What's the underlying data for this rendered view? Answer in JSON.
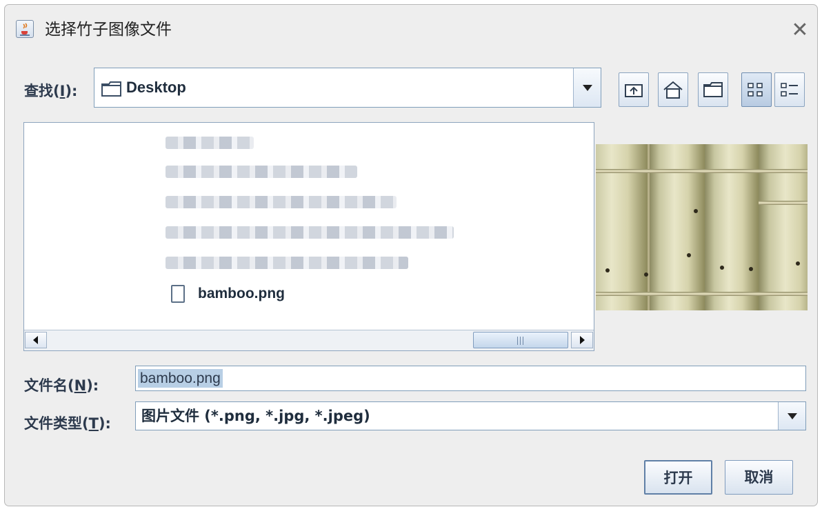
{
  "dialog": {
    "title": "选择竹子图像文件",
    "close_glyph": "✕"
  },
  "look_in": {
    "label": "查找(",
    "mnemonic": "I",
    "label_end": "):",
    "value": "Desktop"
  },
  "toolbar": {
    "buttons": [
      "up-one-level",
      "home",
      "new-folder",
      "list-view",
      "details-view"
    ]
  },
  "file_list": {
    "visible_file": "bamboo.png",
    "blurred_entries": 5
  },
  "file_name": {
    "label": "文件名(",
    "mnemonic": "N",
    "label_end": "):",
    "value": "bamboo.png"
  },
  "file_type": {
    "label": "文件类型(",
    "mnemonic": "T",
    "label_end": "):",
    "value": "图片文件 (*.png, *.jpg, *.jpeg)"
  },
  "buttons": {
    "open": "打开",
    "cancel": "取消"
  },
  "colors": {
    "accent": "#b8cfe5",
    "border": "#7f9db9"
  }
}
